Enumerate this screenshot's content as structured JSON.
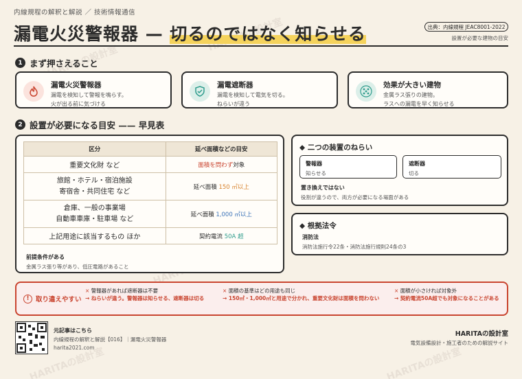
{
  "header": {
    "series": "内線規程の解釈と解説 ／ 技術情報通信",
    "title_main": "漏電火災警報器 — ",
    "title_highlight": "切るのではなく知らせる",
    "source": "出典：内線規程 JEAC8001-2022",
    "source_note": "設置が必要な建物の目安"
  },
  "section1": {
    "num": "1",
    "title": "まず押さえること",
    "cards": [
      {
        "title": "漏電火災警報器",
        "lines": [
          "漏電を検知して警報を鳴らす。",
          "火が出る前に気づける"
        ],
        "icon": "flame-icon",
        "color": "#c9442f"
      },
      {
        "title": "漏電遮断器",
        "lines": [
          "漏電を検知して電気を切る。",
          "ねらいが違う"
        ],
        "icon": "shield-check-icon",
        "color": "#2e9c8c"
      },
      {
        "title": "効果が大きい建物",
        "lines": [
          "金属ラス張りの建物。",
          "ラスへの漏電を早く知らせる"
        ],
        "icon": "grid-dots-icon",
        "color": "#2e9c8c"
      }
    ]
  },
  "section2": {
    "num": "2",
    "title": "設置が必要になる目安 —— 早見表",
    "table": {
      "headers": [
        "区分",
        "延べ面積などの目安"
      ],
      "rows": [
        {
          "kubun": [
            "重要文化財 など"
          ],
          "pre": "",
          "val": "面積を問わず",
          "post": "対象",
          "color": "red"
        },
        {
          "kubun": [
            "旅館・ホテル・宿泊施設",
            "寄宿舎・共同住宅 など"
          ],
          "pre": "延べ面積 ",
          "val": "150 ㎡以上",
          "post": "",
          "color": "orange"
        },
        {
          "kubun": [
            "倉庫、一般の事業場",
            "自動車車庫・駐車場 など"
          ],
          "pre": "延べ面積 ",
          "val": "1,000 ㎡以上",
          "post": "",
          "color": "blue"
        },
        {
          "kubun": [
            "上記用途に該当するもの ほか"
          ],
          "pre": "契約電流 ",
          "val": "50A 超",
          "post": "",
          "color": "teal"
        }
      ]
    },
    "premise_title": "前提条件がある",
    "premise_text": "金属ラス張り等があり、低圧電路があること"
  },
  "aim": {
    "title": "二つの装置のねらい",
    "alarm_title": "警報器",
    "alarm_text": "知らせる",
    "breaker_title": "遮断器",
    "breaker_text": "切る",
    "note_title": "置き換えではない",
    "note_text": "役割が違うので、両方が必要になる場面がある"
  },
  "law": {
    "title": "根拠法令",
    "sub": "消防法",
    "text": "消防法施行令22条・消防法施行規則24条の3"
  },
  "mistakes": {
    "label": "取り違えやすい",
    "items": [
      {
        "q": "警報器があれば遮断器は不要",
        "a": "→ ねらいが違う。警報器は知らせる、遮断器は切る"
      },
      {
        "q": "面積の基準はどの用途も同じ",
        "a": "→ 150㎡・1,000㎡と用途で分かれ、重要文化財は面積を問わない"
      },
      {
        "q": "面積が小さければ対象外",
        "a": "→ 契約電流50A超でも対象になることがある"
      }
    ]
  },
  "footer": {
    "orig_title": "元記事はこちら",
    "orig_text": "内線規程の解釈と解説【016】｜漏電火災警報器",
    "url": "harita2021.com",
    "brand": "HARITAの設計室",
    "brand_sub": "電気設備設計・施工者のための解説サイト"
  },
  "watermark": "HARITAの設計室"
}
